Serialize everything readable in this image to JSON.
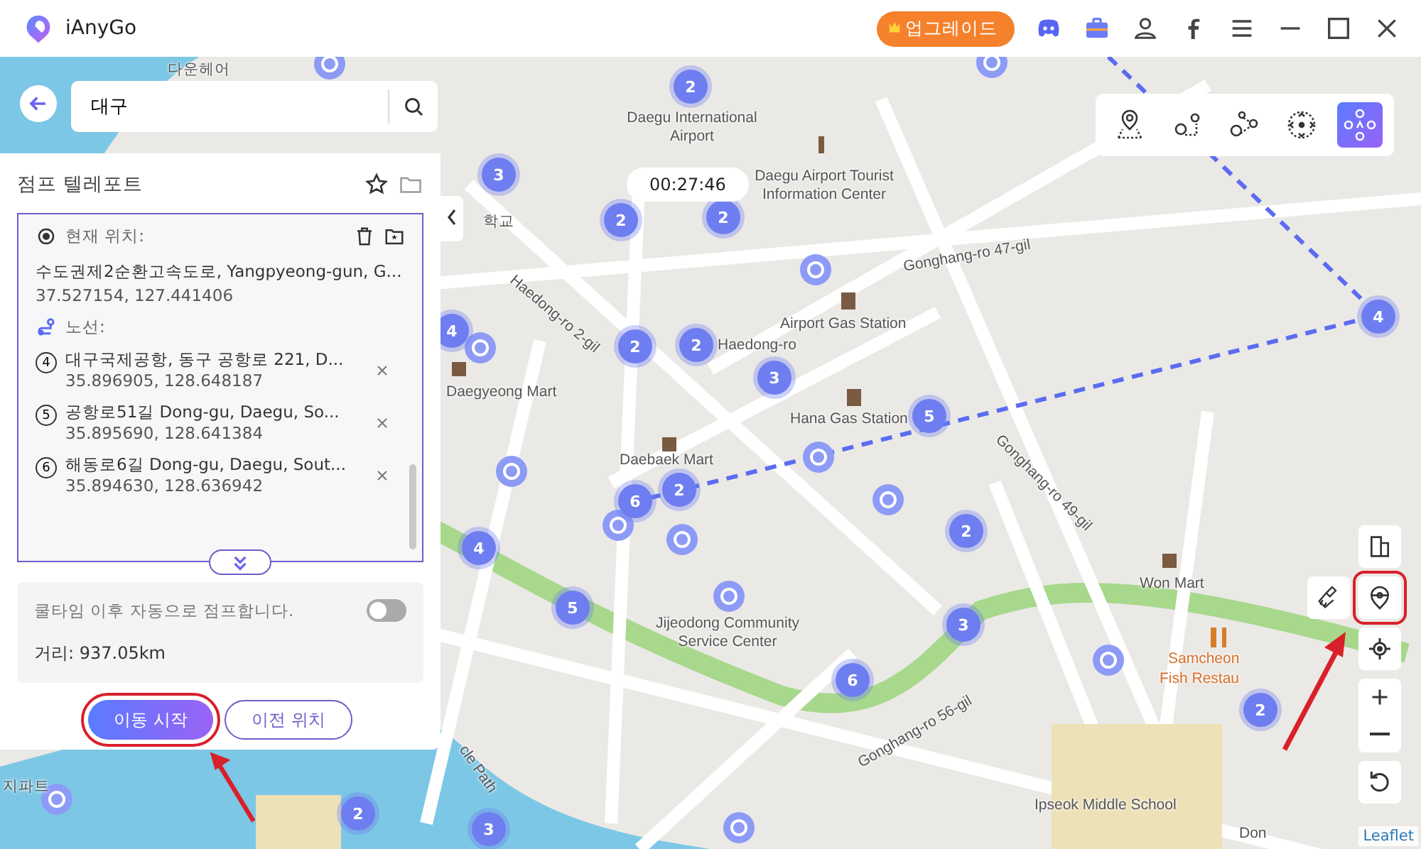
{
  "app": {
    "name": "iAnyGo"
  },
  "header": {
    "upgrade_button": "업그레이드"
  },
  "search": {
    "value": "대구"
  },
  "panel": {
    "title": "점프 텔레포트",
    "current_location": {
      "label": "현재 위치:",
      "address": "수도권제2순환고속도로, Yangpyeong-gun, G...",
      "coords": "37.527154, 127.441406"
    },
    "route": {
      "label": "노선:",
      "points": [
        {
          "number": "4",
          "address": "대구국제공항, 동구 공항로 221, D...",
          "coords": "35.896905, 128.648187"
        },
        {
          "number": "5",
          "address": "공항로51길 Dong-gu, Daegu, So...",
          "coords": "35.895690, 128.641384"
        },
        {
          "number": "6",
          "address": "해동로6길 Dong-gu, Daegu, Sout...",
          "coords": "35.894630, 128.636942"
        }
      ]
    },
    "auto_jump": {
      "label": "쿨타임 이후 자동으로 점프합니다.",
      "on": false
    },
    "distance": "거리: 937.05km",
    "buttons": [
      {
        "label": "이동 시작",
        "kind": "primary"
      },
      {
        "label": "이전 위치",
        "kind": "outline"
      }
    ]
  },
  "mode_toolbar": {
    "modes": [
      {
        "selected": false
      },
      {
        "selected": false
      },
      {
        "selected": false
      },
      {
        "selected": false
      },
      {
        "selected": true
      }
    ]
  },
  "map": {
    "timer": "00:27:46",
    "labels": [
      "다운헤어",
      "Daegu International Airport",
      "Daegu Airport Tourist Information Center",
      "Gonghang-ro 47-gil",
      "Airport Gas Station",
      "Haedong-ro 2-gil",
      "Haedong-ro",
      "Daegyeong Mart",
      "Hana Gas Station",
      "Gonghang-ro 49-gil",
      "Daebaek Mart",
      "Won Mart",
      "Jijeodong Community Service Center",
      "Samcheon",
      "Fish Restau",
      "Gonghang-ro 56-gil",
      "Ipseok Middle School",
      "학교",
      "cle Path",
      "지파트",
      "Don"
    ],
    "clusters": [
      "2",
      "3",
      "2",
      "2",
      "4",
      "2",
      "2",
      "3",
      "5",
      "6",
      "2",
      "2",
      "4",
      "5",
      "3",
      "2",
      "6",
      "3",
      "2",
      "4"
    ],
    "attribution": "Leaflet"
  }
}
